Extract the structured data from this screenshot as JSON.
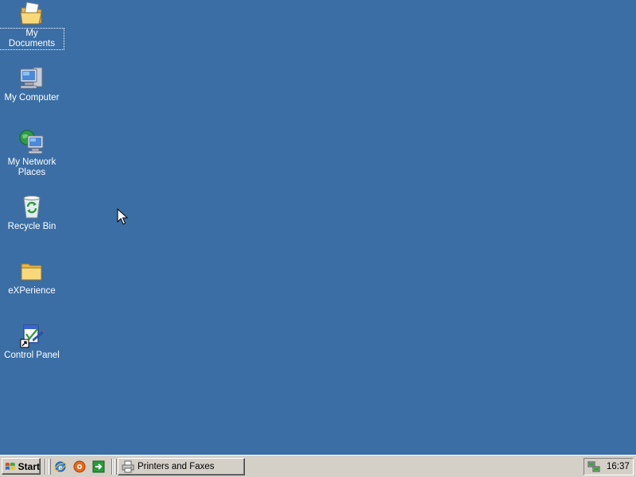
{
  "desktop": {
    "background": "#3a6ea5",
    "icons": [
      {
        "label": "My Documents",
        "icon": "documents-folder-icon"
      },
      {
        "label": "My Computer",
        "icon": "computer-icon"
      },
      {
        "label": "My Network Places",
        "icon": "network-places-icon"
      },
      {
        "label": "Recycle Bin",
        "icon": "recycle-bin-icon"
      },
      {
        "label": "eXPerience",
        "icon": "folder-icon"
      },
      {
        "label": "Control Panel",
        "icon": "control-panel-shortcut-icon"
      }
    ]
  },
  "taskbar": {
    "start_label": "Start",
    "quick_launch": [
      {
        "icon": "internet-explorer-icon"
      },
      {
        "icon": "media-player-icon"
      },
      {
        "icon": "show-desktop-icon"
      }
    ],
    "tasks": [
      {
        "label": "Printers and Faxes",
        "icon": "printer-icon"
      }
    ],
    "tray": {
      "icons": [
        {
          "icon": "network-connection-icon"
        }
      ],
      "clock": "16:37"
    }
  }
}
